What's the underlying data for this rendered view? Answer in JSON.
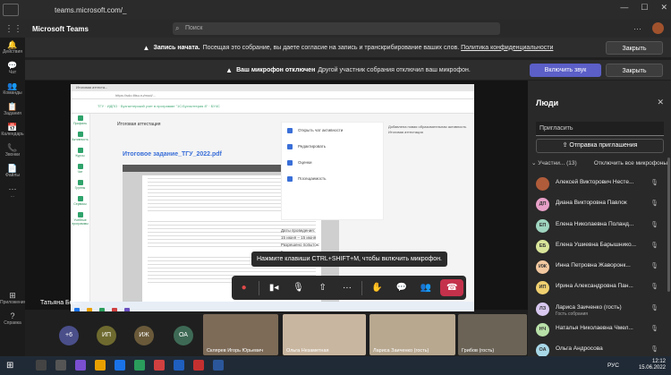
{
  "browser": {
    "url": "teams.microsoft.com/_"
  },
  "teams": {
    "app_title": "Microsoft Teams",
    "search_placeholder": "Поиск"
  },
  "rail": [
    {
      "label": "Действия",
      "icon": "bell-icon"
    },
    {
      "label": "Чат",
      "icon": "chat-icon"
    },
    {
      "label": "Команды",
      "icon": "teams-icon"
    },
    {
      "label": "Задания",
      "icon": "assignments-icon"
    },
    {
      "label": "Календарь",
      "icon": "calendar-icon"
    },
    {
      "label": "Звонки",
      "icon": "phone-icon"
    },
    {
      "label": "Файлы",
      "icon": "files-icon"
    },
    {
      "label": "...",
      "icon": "more-icon"
    },
    {
      "label": "Приложения",
      "icon": "apps-icon"
    },
    {
      "label": "Справка",
      "icon": "help-icon"
    }
  ],
  "banner_record": {
    "bold": "Запись начата.",
    "text": "Посещая это собрание, вы даете согласие на запись и транскрибирование ваших слов.",
    "link": "Политика конфиденциальности",
    "button": "Закрыть"
  },
  "banner_mic": {
    "bold": "Ваш микрофон отключен",
    "text": "Другой участник собрания отключил ваш микрофон.",
    "button_unmute": "Включить звук",
    "button_close": "Закрыть"
  },
  "shared": {
    "tab_title": "Итоговая аттеста...",
    "address": "https://sdo.tltsu.ru/mod/...",
    "crumbs": "ТГУ · ИДПО · Бухгалтерский учет в программе \"1С:Бухгалтерия 8\" · БУ4С",
    "doc_head": "Итоговая аттестация",
    "doc_title": "Итоговое задание_ТГУ_2022.pdf",
    "panel": [
      "Открыть чат активности",
      "Редактировать",
      "Оценки",
      "Посещаемость"
    ],
    "dates": [
      "Даты проведения:",
      "15 июня – 15 июня",
      "Разрешено попыток:",
      "5"
    ],
    "note": "Добавлена новая образовательная активность Итоговая аттестация",
    "lms_rail": [
      "Профиль",
      "Активность",
      "Курсы",
      "Чат",
      "Группы",
      "Сервисы",
      "Учебные программы"
    ]
  },
  "toast": "Нажмите клавиши CTRL+SHIFT+M, чтобы включить микрофон.",
  "controls": [
    "record-icon",
    "camera-icon",
    "mic-off-icon",
    "share-icon",
    "more-icon",
    "raise-hand-icon",
    "chat-icon",
    "people-icon",
    "hangup-icon"
  ],
  "presenter": "Татьяна Бес...",
  "tiles": {
    "circles": [
      {
        "label": "+6",
        "color": "#4a4f8a"
      },
      {
        "label": "ИП",
        "color": "#6e6a2f"
      },
      {
        "label": "ИЖ",
        "color": "#6a5a3a"
      },
      {
        "label": "ОА",
        "color": "#3e6a55"
      }
    ],
    "videos": [
      {
        "label": "Склярев Игорь Юрьевич",
        "bg": "#7d6b58"
      },
      {
        "label": "Ольга Незаметная",
        "bg": "#c9b6a0"
      },
      {
        "label": "Лариса Заиченко (гость)",
        "bg": "#b8a890"
      },
      {
        "label": "Грибов (гость)",
        "bg": "#6b6356"
      }
    ]
  },
  "people": {
    "heading": "Люди",
    "invite_placeholder": "Пригласить",
    "share_invite": "Отправка приглашения",
    "section_label": "Участни...",
    "section_count": "(13)",
    "mute_all": "Отключить все микрофоны",
    "list": [
      {
        "initials": "",
        "name": "Алексей Викторович Несте...",
        "sub": "",
        "color": "#b05c3a"
      },
      {
        "initials": "ДП",
        "name": "Диана Викторовна Павлок",
        "sub": "",
        "color": "#e8a0c8"
      },
      {
        "initials": "ЕП",
        "name": "Елена Николаевна Поланд...",
        "sub": "",
        "color": "#9fd5c0"
      },
      {
        "initials": "ЕБ",
        "name": "Елена Ушиевна Барышнико...",
        "sub": "",
        "color": "#d9e59a"
      },
      {
        "initials": "ИЖ",
        "name": "Инна Петровна Жаворонк...",
        "sub": "",
        "color": "#f2c8a0"
      },
      {
        "initials": "ИП",
        "name": "Ирина Александровна Пан...",
        "sub": "",
        "color": "#f0d070"
      },
      {
        "initials": "ЛЗ",
        "name": "Лариса Заиченко (гость)",
        "sub": "Гость собрания",
        "color": "#d8c8f0"
      },
      {
        "initials": "НЧ",
        "name": "Наталья Николаевна Чмел...",
        "sub": "",
        "color": "#b8e0a8"
      },
      {
        "initials": "ОА",
        "name": "Ольга Андросова",
        "sub": "",
        "color": "#a8d8e8"
      }
    ]
  },
  "taskbar": {
    "lang": "РУС",
    "time": "12:12",
    "date": "15.06.2022"
  }
}
